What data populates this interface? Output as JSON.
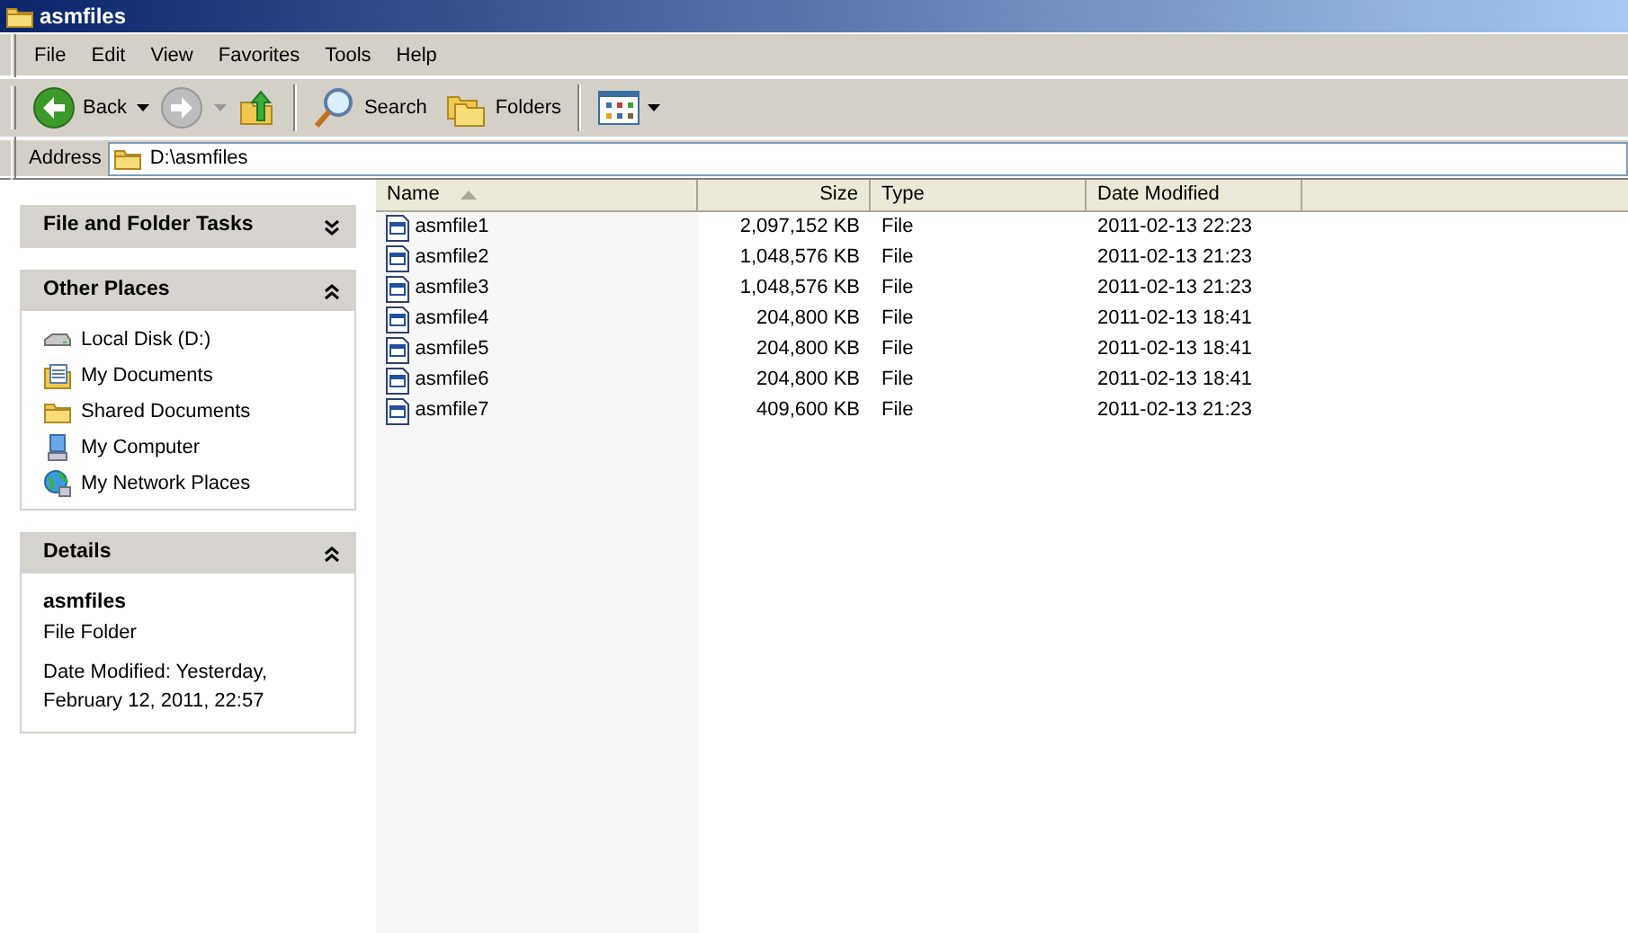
{
  "window": {
    "title": "asmfiles"
  },
  "menu": [
    "File",
    "Edit",
    "View",
    "Favorites",
    "Tools",
    "Help"
  ],
  "toolbar": {
    "back": "Back",
    "search": "Search",
    "folders": "Folders",
    "forward_disabled": true
  },
  "address": {
    "label": "Address",
    "value": "D:\\asmfiles"
  },
  "task_panels": [
    {
      "title": "File and Folder Tasks",
      "expanded": false
    },
    {
      "kind": "places",
      "title": "Other Places",
      "expanded": true,
      "items": [
        {
          "kind": "disk",
          "label": "Local Disk (D:)"
        },
        {
          "kind": "documents",
          "label": "My Documents"
        },
        {
          "kind": "folder",
          "label": "Shared Documents"
        },
        {
          "kind": "computer",
          "label": "My Computer"
        },
        {
          "kind": "network",
          "label": "My Network Places"
        }
      ]
    },
    {
      "kind": "details",
      "title": "Details",
      "expanded": true,
      "name": "asmfiles",
      "type": "File Folder",
      "modified": "Date Modified: Yesterday, February 12, 2011, 22:57"
    }
  ],
  "table": {
    "columns": [
      {
        "label": "Name",
        "sorted": true
      },
      {
        "label": "Size",
        "sorted": false
      },
      {
        "label": "Type",
        "sorted": false
      },
      {
        "label": "Date Modified",
        "sorted": false
      }
    ],
    "rows": [
      [
        "asmfile1",
        "2,097,152 KB",
        "File",
        "2011-02-13 22:23"
      ],
      [
        "asmfile2",
        "1,048,576 KB",
        "File",
        "2011-02-13 21:23"
      ],
      [
        "asmfile3",
        "1,048,576 KB",
        "File",
        "2011-02-13 21:23"
      ],
      [
        "asmfile4",
        "204,800 KB",
        "File",
        "2011-02-13 18:41"
      ],
      [
        "asmfile5",
        "204,800 KB",
        "File",
        "2011-02-13 18:41"
      ],
      [
        "asmfile6",
        "204,800 KB",
        "File",
        "2011-02-13 18:41"
      ],
      [
        "asmfile7",
        "409,600 KB",
        "File",
        "2011-02-13 21:23"
      ]
    ]
  }
}
